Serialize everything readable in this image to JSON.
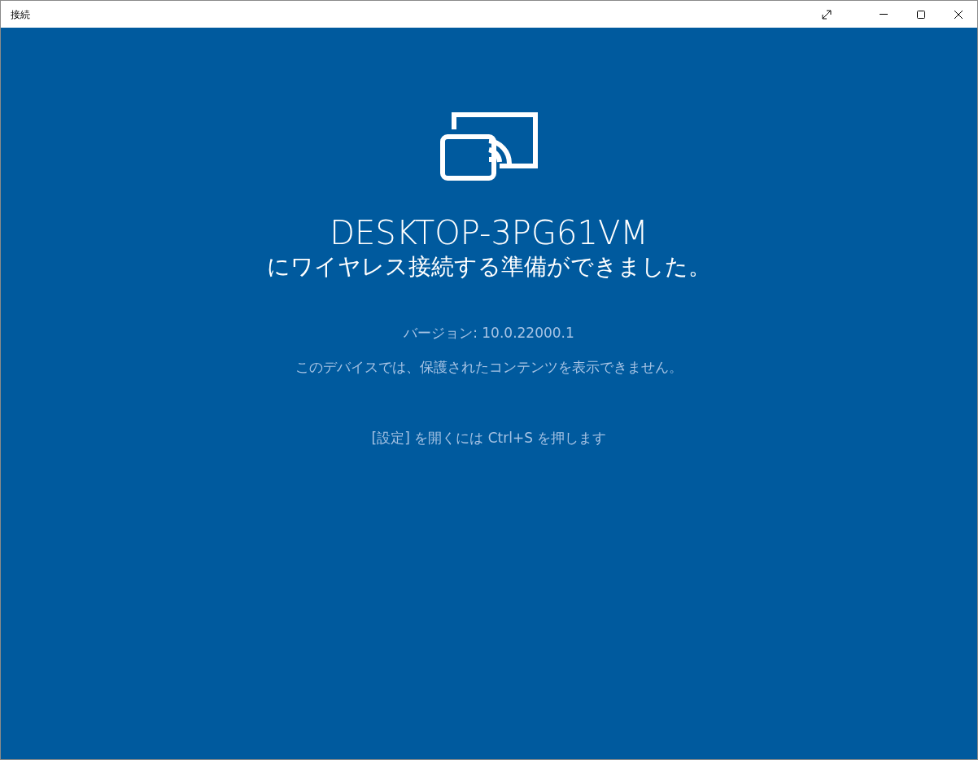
{
  "window": {
    "title": "接続"
  },
  "device_name": "DESKTOP-3PG61VM",
  "status_message": "にワイヤレス接続する準備ができました。",
  "version": "バージョン: 10.0.22000.1",
  "protected_content_note": "このデバイスでは、保護されたコンテンツを表示できません。",
  "settings_hint": "[設定] を開くには Ctrl+S を押します"
}
